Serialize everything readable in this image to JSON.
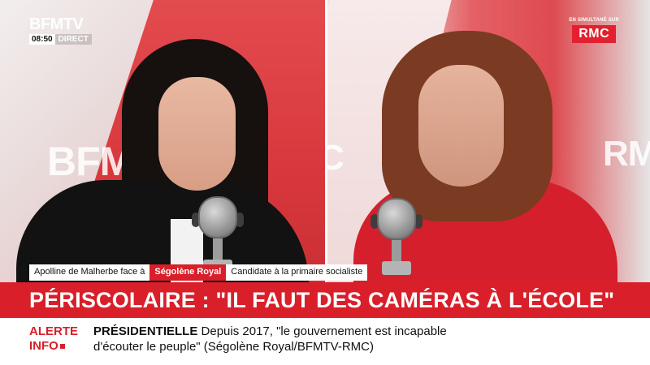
{
  "channel": {
    "logo": "BFMTV",
    "time": "08:50",
    "live_label": "DIRECT"
  },
  "simulcast": {
    "label": "EN SIMULTANÉ SUR",
    "partner": "RMC"
  },
  "studio": {
    "left_wall_text": "BFM",
    "right_wall_text_a": "C",
    "right_wall_text_b": "RM"
  },
  "lower_third": {
    "host": "Apolline de Malherbe face à",
    "guest": "Ségolène Royal",
    "guest_role": "Candidate à la primaire socialiste"
  },
  "headline": "PÉRISCOLAIRE : \"IL FAUT DES CAMÉRAS À L'ÉCOLE\"",
  "ticker": {
    "alert_line1": "ALERTE",
    "alert_line2": "INFO",
    "keyword": "PRÉSIDENTIELLE",
    "text_line1": "Depuis 2017, \"le gouvernement est incapable",
    "text_line2": "d'écouter le peuple\" (Ségolène Royal/BFMTV-RMC)"
  },
  "colors": {
    "brand_red": "#d81f2a",
    "rmc_red": "#e3202e",
    "white": "#ffffff"
  }
}
